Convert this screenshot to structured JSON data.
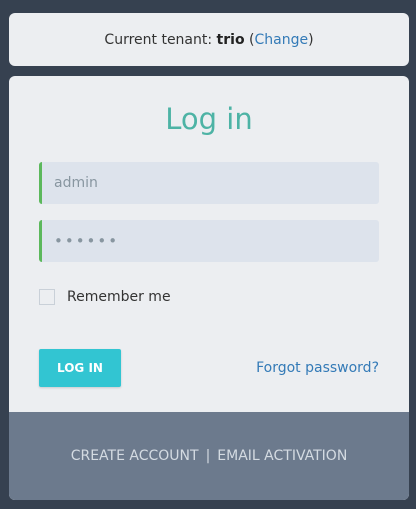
{
  "tenant": {
    "prefix": "Current tenant:",
    "name": "trio",
    "open_paren": "(",
    "change_label": "Change",
    "close_paren": ")"
  },
  "login": {
    "title": "Log in",
    "username_value": "admin",
    "password_value": "••••••",
    "remember_label": "Remember me",
    "remember_checked": false,
    "login_button_label": "LOG IN",
    "forgot_label": "Forgot password?"
  },
  "footer": {
    "create_account_label": "CREATE ACCOUNT",
    "separator": "|",
    "email_activation_label": "EMAIL ACTIVATION"
  },
  "colors": {
    "background": "#364150",
    "accent_title": "#4db3a5",
    "button": "#32c5d2",
    "link": "#337ab7",
    "field_border": "#5cb85c",
    "footer": "#6c7a8d"
  }
}
